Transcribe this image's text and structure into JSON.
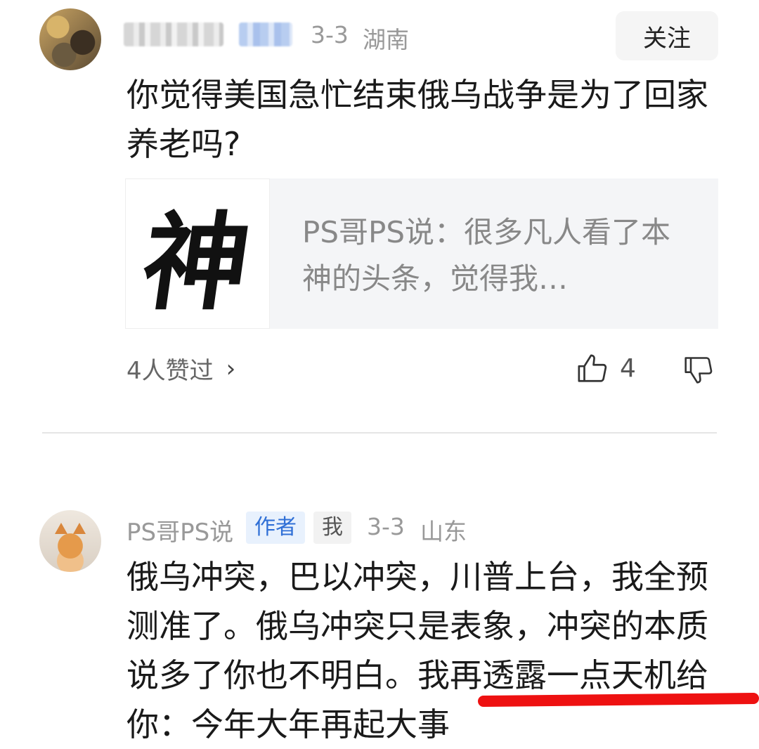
{
  "comment1": {
    "date": "3-3",
    "location": "湖南",
    "follow_label": "关注",
    "text": "你觉得美国急忙结束俄乌战争是为了回家养老吗?",
    "quote": {
      "thumb_char": "神",
      "text": "PS哥PS说：很多凡人看了本神的头条，觉得我…"
    },
    "likes_summary": "4人赞过",
    "like_count": "4"
  },
  "comment2": {
    "author": "PS哥PS说",
    "author_badge": "作者",
    "me_badge": "我",
    "date": "3-3",
    "location": "山东",
    "text": "俄乌冲突，巴以冲突，川普上台，我全预测准了。俄乌冲突只是表象，冲突的本质说多了你也不明白。我再透露一点天机给你：今年大年再起大事"
  },
  "colors": {
    "accent_blue": "#2f6fd6",
    "highlight_red": "#ee1111"
  }
}
